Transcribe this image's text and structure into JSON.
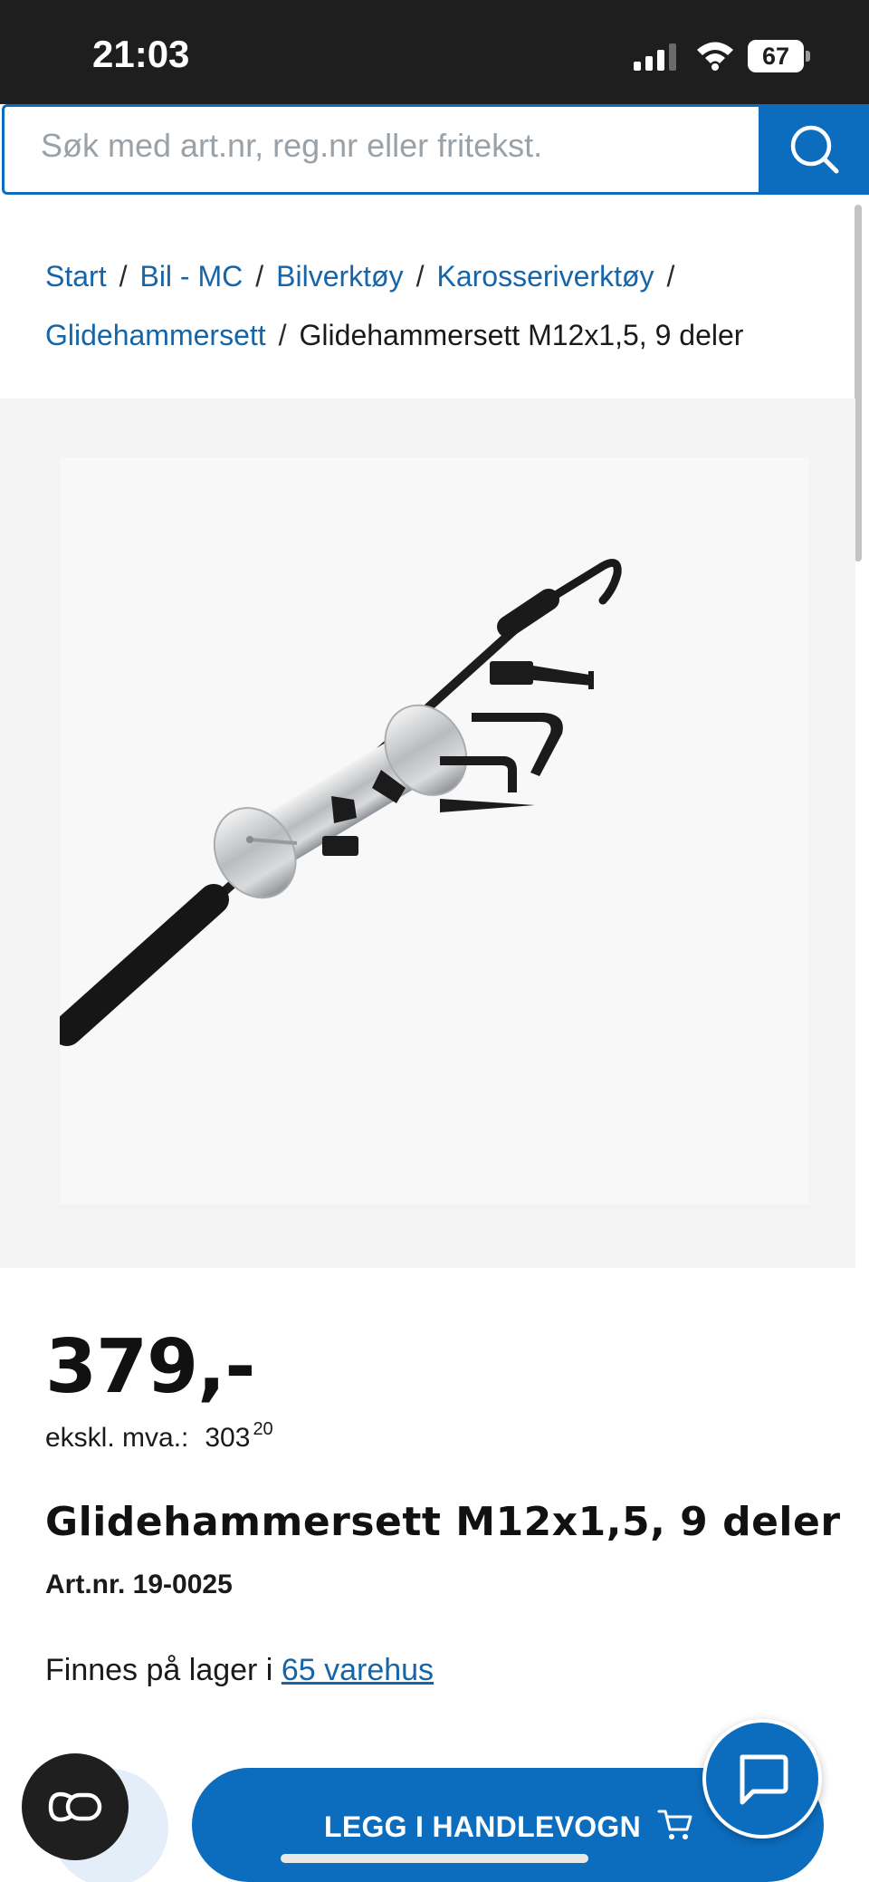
{
  "status_bar": {
    "time": "21:03",
    "battery": "67",
    "icons": [
      "signal-icon",
      "wifi-icon",
      "battery-icon"
    ]
  },
  "search": {
    "placeholder": "Søk med art.nr, reg.nr eller fritekst.",
    "button_icon": "search-icon"
  },
  "breadcrumb": {
    "items": [
      "Start",
      "Bil - MC",
      "Bilverktøy",
      "Karosseriverktøy",
      "Glidehammersett"
    ],
    "current": "Glidehammersett M12x1,5, 9 deler",
    "separator": "/"
  },
  "product": {
    "image_alt": "product-image",
    "price": "379,-",
    "ex_vat_label": "ekskl. mva.:",
    "ex_vat_value": "303",
    "ex_vat_cents": "20",
    "title": "Glidehammersett M12x1,5, 9 deler",
    "art_nr": "Art.nr. 19-0025",
    "stock_prefix": "Finnes på lager i",
    "stock_link": "65 varehus"
  },
  "actions": {
    "add_to_cart": "LEGG I HANDLEVOGN",
    "cart_icon": "cart-icon",
    "chat_icon": "chat-bubble-icon",
    "co_icon": "co-icon"
  },
  "colors": {
    "brand_blue": "#0c6dbf",
    "link_blue": "#1565a8",
    "status_bar": "#1e1e1e"
  }
}
